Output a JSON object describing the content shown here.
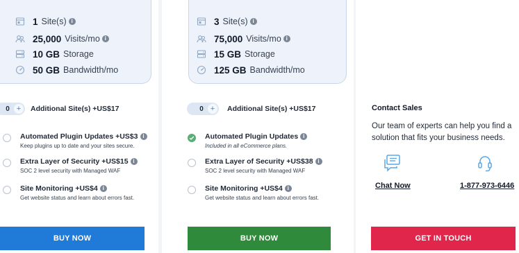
{
  "plans": [
    {
      "specs": [
        {
          "icon": "sites-icon",
          "value": "1",
          "label": "Site(s)",
          "info": true
        },
        {
          "icon": "visits-icon",
          "value": "25,000",
          "label": "Visits/mo",
          "info": true
        },
        {
          "icon": "storage-icon",
          "value": "10 GB",
          "label": "Storage",
          "info": false
        },
        {
          "icon": "bandwidth-icon",
          "value": "50 GB",
          "label": "Bandwidth/mo",
          "info": false
        }
      ],
      "additional_sites": {
        "count": "0",
        "plus": "+",
        "label": "Additional Site(s) +US$17"
      },
      "addons": [
        {
          "title": "Automated Plugin Updates +US$3",
          "desc": "Keep plugins up to date and your sites secure.",
          "checked": false
        },
        {
          "title": "Extra Layer of Security +US$15",
          "desc": "SOC 2 level security with Managed WAF",
          "checked": false
        },
        {
          "title": "Site Monitoring +US$4",
          "desc": "Get website status and learn about errors fast.",
          "checked": false
        }
      ],
      "button_label": "BUY NOW",
      "button_color": "#1f7ad8"
    },
    {
      "specs": [
        {
          "icon": "sites-icon",
          "value": "3",
          "label": "Site(s)",
          "info": true
        },
        {
          "icon": "visits-icon",
          "value": "75,000",
          "label": "Visits/mo",
          "info": true
        },
        {
          "icon": "storage-icon",
          "value": "15 GB",
          "label": "Storage",
          "info": false
        },
        {
          "icon": "bandwidth-icon",
          "value": "125 GB",
          "label": "Bandwidth/mo",
          "info": false
        }
      ],
      "additional_sites": {
        "count": "0",
        "plus": "+",
        "label": "Additional Site(s) +US$17"
      },
      "addons": [
        {
          "title": "Automated Plugin Updates",
          "desc": "Included in all eCommerce plans.",
          "checked": true
        },
        {
          "title": "Extra Layer of Security +US$38",
          "desc": "SOC 2 level security with Managed WAF",
          "checked": false
        },
        {
          "title": "Site Monitoring +US$4",
          "desc": "Get website status and learn about errors fast.",
          "checked": false
        }
      ],
      "button_label": "BUY NOW",
      "button_color": "#2f8a3b"
    }
  ],
  "contact": {
    "title": "Contact Sales",
    "text": "Our team of experts can help you find a solution that fits your business needs.",
    "chat_label": "Chat Now",
    "phone": "1-877-973-6446",
    "button_label": "GET IN TOUCH",
    "button_color": "#e0264a"
  },
  "info_glyph": "i"
}
